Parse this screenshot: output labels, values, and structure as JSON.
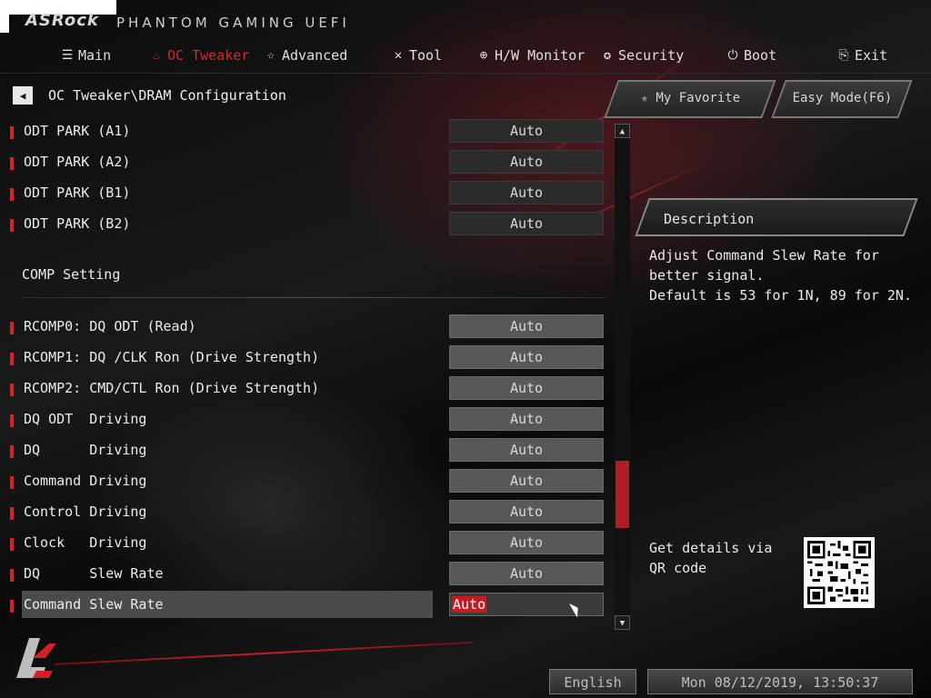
{
  "header": {
    "brand": "ASRock",
    "title": "PHANTOM GAMING UEFI"
  },
  "nav": [
    {
      "label": "Main",
      "icon": "list-icon",
      "active": false
    },
    {
      "label": "OC Tweaker",
      "icon": "flame-icon",
      "active": true
    },
    {
      "label": "Advanced",
      "icon": "star-icon",
      "active": false
    },
    {
      "label": "Tool",
      "icon": "tools-icon",
      "active": false
    },
    {
      "label": "H/W Monitor",
      "icon": "monitor-icon",
      "active": false
    },
    {
      "label": "Security",
      "icon": "shield-icon",
      "active": false
    },
    {
      "label": "Boot",
      "icon": "power-icon",
      "active": false
    },
    {
      "label": "Exit",
      "icon": "exit-icon",
      "active": false
    }
  ],
  "breadcrumb": "OC Tweaker\\DRAM Configuration",
  "buttons": {
    "favorite": "My Favorite",
    "easy_mode": "Easy Mode(F6)"
  },
  "settings_top": [
    {
      "label": "ODT PARK (A1)",
      "value": "Auto"
    },
    {
      "label": "ODT PARK (A2)",
      "value": "Auto"
    },
    {
      "label": "ODT PARK (B1)",
      "value": "Auto"
    },
    {
      "label": "ODT PARK (B2)",
      "value": "Auto"
    }
  ],
  "section_title": "COMP Setting",
  "settings_comp": [
    {
      "label": "RCOMP0: DQ ODT (Read)",
      "value": "Auto"
    },
    {
      "label": "RCOMP1: DQ /CLK Ron (Drive Strength)",
      "value": "Auto"
    },
    {
      "label": "RCOMP2: CMD/CTL Ron (Drive Strength)",
      "value": "Auto"
    },
    {
      "label": "DQ ODT  Driving",
      "value": "Auto"
    },
    {
      "label": "DQ      Driving",
      "value": "Auto"
    },
    {
      "label": "Command Driving",
      "value": "Auto"
    },
    {
      "label": "Control Driving",
      "value": "Auto"
    },
    {
      "label": "Clock   Driving",
      "value": "Auto"
    },
    {
      "label": "DQ      Slew Rate",
      "value": "Auto"
    }
  ],
  "selected_setting": {
    "label": "Command Slew Rate",
    "value": "Auto"
  },
  "description": {
    "title": "Description",
    "text": "Adjust Command Slew Rate for\nbetter signal.\nDefault is 53 for 1N, 89 for 2N.",
    "qr_text": "Get details via QR code"
  },
  "footer": {
    "language": "English",
    "datetime": "Mon 08/12/2019, 13:50:37"
  },
  "colors": {
    "accent": "#d8202a",
    "active_nav": "#e0232a"
  }
}
